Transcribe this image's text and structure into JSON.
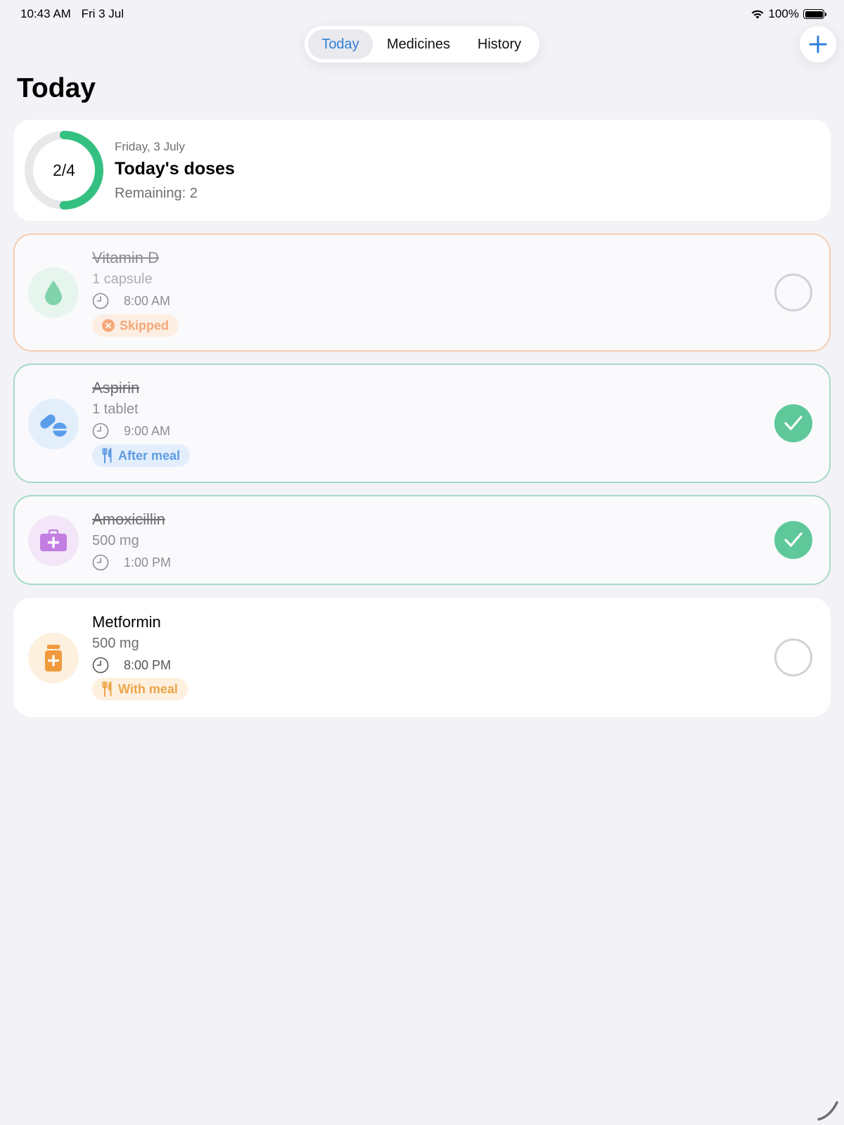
{
  "status_bar": {
    "time": "10:43 AM",
    "date": "Fri 3 Jul",
    "battery": "100%"
  },
  "nav": {
    "tabs": [
      {
        "label": "Today",
        "active": true
      },
      {
        "label": "Medicines",
        "active": false
      },
      {
        "label": "History",
        "active": false
      }
    ],
    "add_icon": "plus-icon"
  },
  "page": {
    "title": "Today"
  },
  "summary": {
    "date": "Friday, 3 July",
    "title": "Today's doses",
    "remaining": "Remaining: 2",
    "progress_label": "2/4",
    "taken": 2,
    "total": 4,
    "ring_color": "#34c081"
  },
  "medications": [
    {
      "name": "Vitamin D",
      "dose": "1 capsule",
      "time": "8:00 AM",
      "status": "skipped",
      "icon": "drop-icon",
      "icon_color": "#7fd3ac",
      "icon_bg": "#e7f5ef",
      "tag": "Skipped",
      "tag_icon": "x-circle-icon"
    },
    {
      "name": "Aspirin",
      "dose": "1 tablet",
      "time": "9:00 AM",
      "status": "taken",
      "icon": "pills-icon",
      "icon_color": "#5a9eea",
      "icon_bg": "#e3eefb",
      "tag": "After meal",
      "tag_icon": "fork-knife-icon"
    },
    {
      "name": "Amoxicillin",
      "dose": "500 mg",
      "time": "1:00 PM",
      "status": "taken",
      "icon": "medkit-icon",
      "icon_color": "#c27ee0",
      "icon_bg": "#f3e6f8",
      "tag": "",
      "tag_icon": ""
    },
    {
      "name": "Metformin",
      "dose": "500 mg",
      "time": "8:00 PM",
      "status": "pending",
      "icon": "pill-bottle-icon",
      "icon_color": "#f09a3c",
      "icon_bg": "#fdf0df",
      "tag": "With meal",
      "tag_icon": "fork-knife-icon"
    }
  ]
}
